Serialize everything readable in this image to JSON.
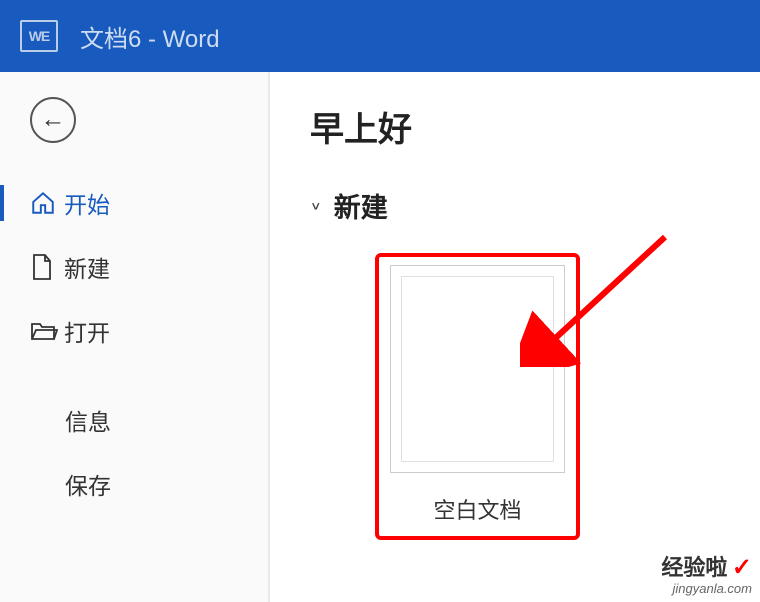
{
  "titlebar": {
    "app_icon_text": "WE",
    "document_title": "文档6  -  Word"
  },
  "sidebar": {
    "items": [
      {
        "label": "开始"
      },
      {
        "label": "新建"
      },
      {
        "label": "打开"
      }
    ],
    "secondary": [
      {
        "label": "信息"
      },
      {
        "label": "保存"
      }
    ]
  },
  "main": {
    "greeting": "早上好",
    "section_title": "新建",
    "templates": [
      {
        "label": "空白文档"
      }
    ]
  },
  "watermark": {
    "main": "经验啦",
    "sub": "jingyanla.com"
  }
}
